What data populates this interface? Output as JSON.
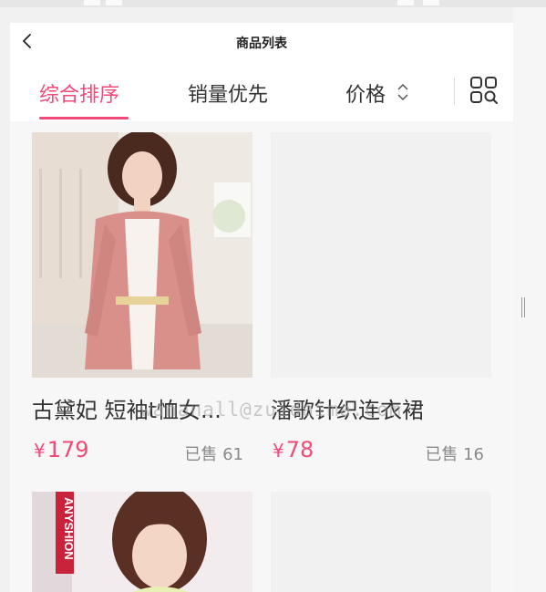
{
  "nav": {
    "title": "商品列表"
  },
  "tabs": [
    {
      "label": "综合排序",
      "active": true
    },
    {
      "label": "销量优先",
      "active": false
    },
    {
      "label": "价格",
      "active": false
    }
  ],
  "products": [
    {
      "name": "古黛妃 短袖t恤女...",
      "currency": "¥",
      "price": "179",
      "sold": "已售 61"
    },
    {
      "name": "潘歌针织连衣裙",
      "currency": "¥",
      "price": "78",
      "sold": "已售 16"
    }
  ],
  "brand_text": "ANYSHION",
  "watermark": "wananall@zuidaima.com",
  "colors": {
    "accent": "#ef4a78",
    "text": "#333333",
    "muted": "#8a8a8a",
    "placeholder": "#f1f1f1"
  },
  "icons": {
    "back": "chevron-left-icon",
    "sort": "sort-updown-icon",
    "layout": "grid-view-icon"
  }
}
